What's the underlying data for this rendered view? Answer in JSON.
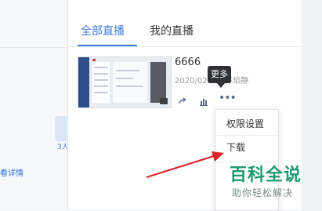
{
  "background": {
    "count_text": "3人",
    "detail_link": "看详情"
  },
  "tabs": [
    {
      "label": "全部直播"
    },
    {
      "label": "我的直播"
    }
  ],
  "video": {
    "title": "6666",
    "meta": "2020/02  3秒  陈焰静"
  },
  "tooltip": {
    "label": "更多"
  },
  "menu": {
    "items": [
      {
        "label": "权限设置"
      },
      {
        "label": "下载"
      }
    ]
  },
  "watermark": {
    "main": "百科全说",
    "sub": "助你轻松解决"
  },
  "colors": {
    "accent": "#3e7bdc",
    "arrow": "#d9252a",
    "watermark": "#1f9b6e"
  },
  "icons": [
    "share-icon",
    "stats-icon",
    "more-icon"
  ]
}
